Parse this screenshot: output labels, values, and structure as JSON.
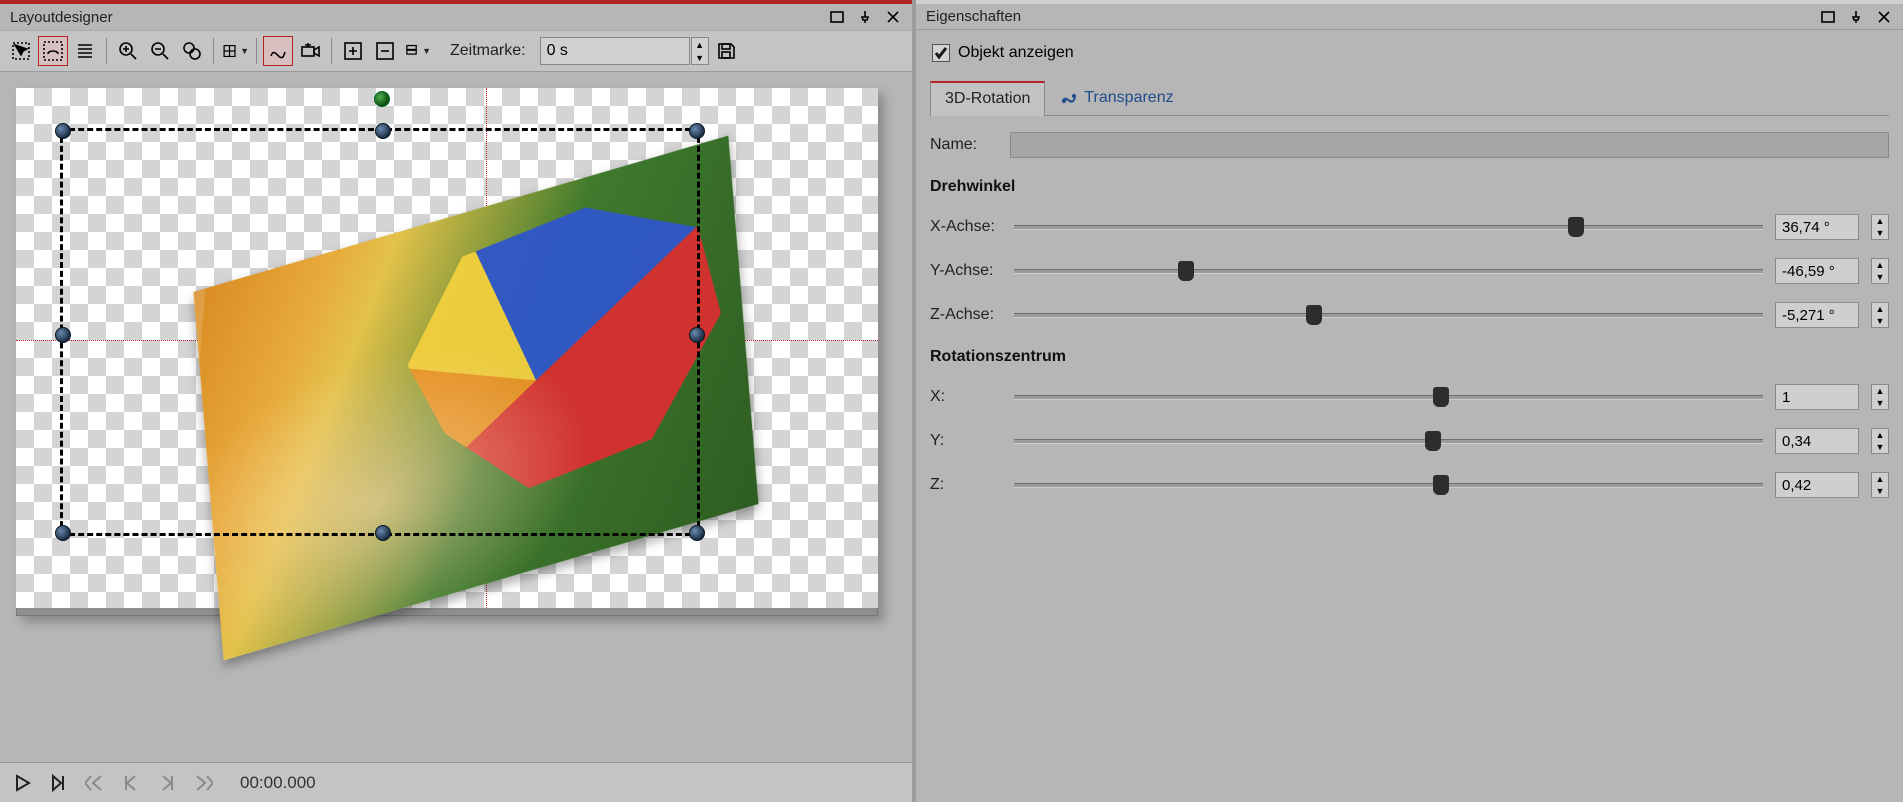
{
  "left": {
    "title": "Layoutdesigner",
    "toolbar": {
      "zeitmarke_label": "Zeitmarke:",
      "zeitmarke_value": "0 s"
    },
    "playbar": {
      "time": "00:00.000"
    }
  },
  "right": {
    "title": "Eigenschaften",
    "show_object_label": "Objekt anzeigen",
    "show_object_checked": true,
    "tabs": {
      "rotation": "3D-Rotation",
      "transparency": "Transparenz"
    },
    "name_label": "Name:",
    "name_value": "",
    "angle_section": "Drehwinkel",
    "center_section": "Rotationszentrum",
    "angles": {
      "x": {
        "label": "X-Achse:",
        "value": "36,74 °",
        "pos": 0.75
      },
      "y": {
        "label": "Y-Achse:",
        "value": "-46,59 °",
        "pos": 0.23
      },
      "z": {
        "label": "Z-Achse:",
        "value": "-5,271 °",
        "pos": 0.4
      }
    },
    "center": {
      "x": {
        "label": "X:",
        "value": "1",
        "pos": 0.57
      },
      "y": {
        "label": "Y:",
        "value": "0,34",
        "pos": 0.56
      },
      "z": {
        "label": "Z:",
        "value": "0,42",
        "pos": 0.57
      }
    }
  }
}
